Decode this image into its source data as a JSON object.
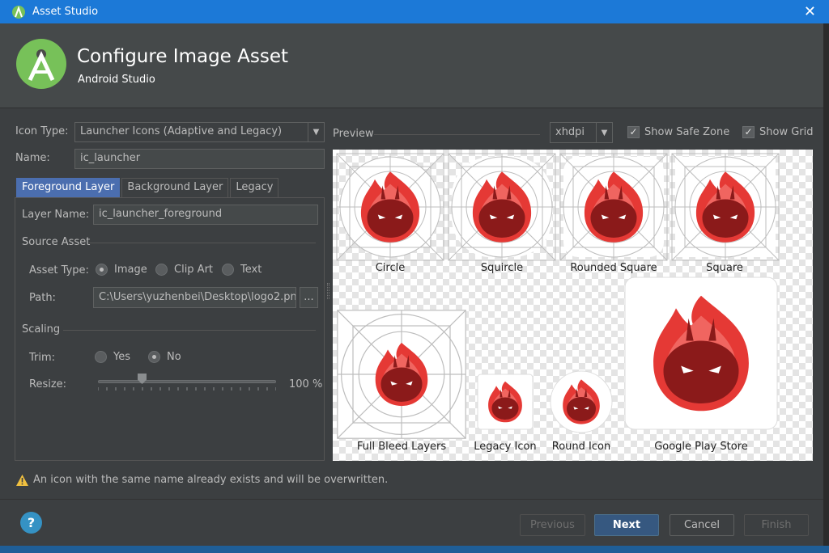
{
  "window": {
    "title": "Asset Studio",
    "close_glyph": "✕"
  },
  "header": {
    "title": "Configure Image Asset",
    "subtitle": "Android Studio"
  },
  "form": {
    "icon_type_label": "Icon Type:",
    "icon_type_value": "Launcher Icons (Adaptive and Legacy)",
    "name_label": "Name:",
    "name_value": "ic_launcher"
  },
  "tabs": [
    "Foreground Layer",
    "Background Layer",
    "Legacy"
  ],
  "layer": {
    "layer_name_label": "Layer Name:",
    "layer_name_value": "ic_launcher_foreground",
    "source_asset_title": "Source Asset",
    "asset_type_label": "Asset Type:",
    "asset_types": [
      "Image",
      "Clip Art",
      "Text"
    ],
    "asset_type_selected": "Image",
    "path_label": "Path:",
    "path_value": "C:\\Users\\yuzhenbei\\Desktop\\logo2.pn",
    "browse_label": "...",
    "scaling_title": "Scaling",
    "trim_label": "Trim:",
    "trim_yes": "Yes",
    "trim_no": "No",
    "trim_selected": "No",
    "resize_label": "Resize:",
    "resize_value": "100 %"
  },
  "preview": {
    "label": "Preview",
    "density": "xhdpi",
    "show_safe_zone": "Show Safe Zone",
    "show_grid": "Show Grid",
    "captions": [
      "Circle",
      "Squircle",
      "Rounded Square",
      "Square",
      "Full Bleed Layers",
      "Legacy Icon",
      "Round Icon",
      "Google Play Store"
    ]
  },
  "warning": "An icon with the same name already exists and will be overwritten.",
  "buttons": {
    "help": "?",
    "previous": "Previous",
    "next": "Next",
    "cancel": "Cancel",
    "finish": "Finish"
  },
  "colors": {
    "accent": "#1c79d7",
    "tab_active": "#4b6eaf",
    "primary_button": "#365880"
  }
}
